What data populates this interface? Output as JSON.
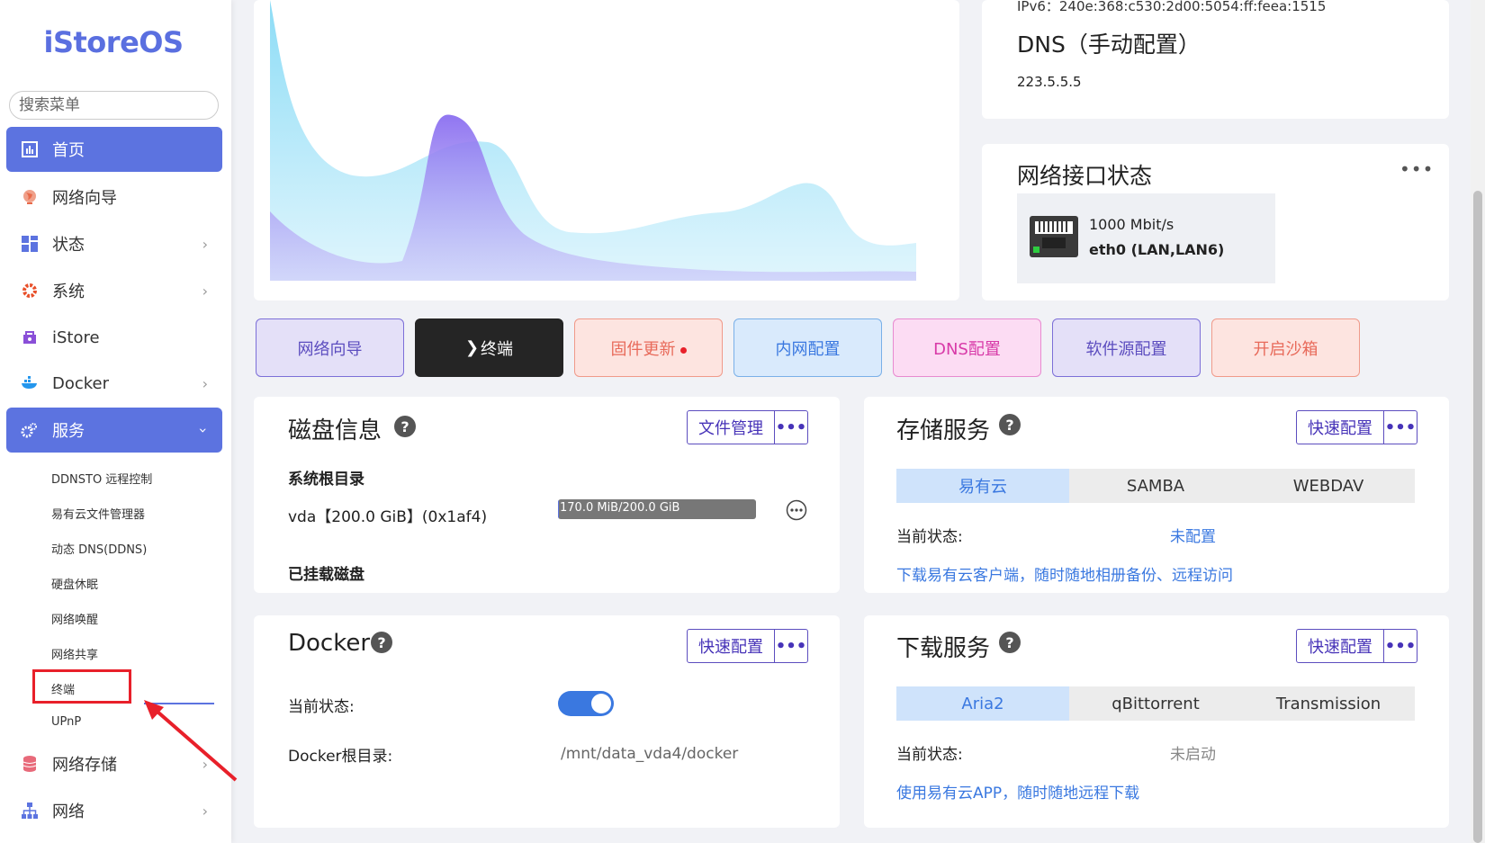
{
  "sidebar": {
    "logo": "iStoreOS",
    "search_placeholder": "搜索菜单",
    "items": [
      {
        "label": "首页",
        "icon": "dashboard-icon"
      },
      {
        "label": "网络向导",
        "icon": "globe-icon"
      },
      {
        "label": "状态",
        "icon": "grid-icon"
      },
      {
        "label": "系统",
        "icon": "gear-icon"
      },
      {
        "label": "iStore",
        "icon": "store-icon"
      },
      {
        "label": "Docker",
        "icon": "docker-icon"
      },
      {
        "label": "服务",
        "icon": "services-icon"
      },
      {
        "label": "网络存储",
        "icon": "storage-icon"
      },
      {
        "label": "网络",
        "icon": "network-icon"
      }
    ],
    "sub_items": [
      "DDNSTO 远程控制",
      "易有云文件管理器",
      "动态 DNS(DDNS)",
      "硬盘休眠",
      "网络唤醒",
      "网络共享",
      "终端",
      "UPnP"
    ]
  },
  "network": {
    "ipv6": "IPv6：240e:368:c530:2d00:5054:ff:feea:1515",
    "dns_title": "DNS（手动配置）",
    "dns_value": "223.5.5.5"
  },
  "interface": {
    "title": "网络接口状态",
    "speed": "1000 Mbit/s",
    "name": "eth0 (LAN,LAN6)"
  },
  "actions": [
    {
      "label": "网络向导"
    },
    {
      "label": "终端",
      "prefix": "❯"
    },
    {
      "label": "固件更新"
    },
    {
      "label": "内网配置"
    },
    {
      "label": "DNS配置"
    },
    {
      "label": "软件源配置"
    },
    {
      "label": "开启沙箱"
    }
  ],
  "disk": {
    "title": "磁盘信息",
    "button": "文件管理",
    "root_label": "系统根目录",
    "vda": "vda【200.0 GiB】(0x1af4)",
    "usage_text": "170.0 MiB/200.0 GiB",
    "usage_fraction": 0.0008,
    "mounted_label": "已挂载磁盘"
  },
  "storage": {
    "title": "存储服务",
    "button": "快速配置",
    "tabs": [
      "易有云",
      "SAMBA",
      "WEBDAV"
    ],
    "status_label": "当前状态:",
    "status_value": "未配置",
    "link": "下载易有云客户端，随时随地相册备份、远程访问"
  },
  "docker": {
    "title": "Docker",
    "button": "快速配置",
    "status_label": "当前状态:",
    "root_label": "Docker根目录:",
    "root_value": "/mnt/data_vda4/docker",
    "enabled": true
  },
  "download": {
    "title": "下载服务",
    "button": "快速配置",
    "tabs": [
      "Aria2",
      "qBittorrent",
      "Transmission"
    ],
    "status_label": "当前状态:",
    "status_value": "未启动",
    "link": "使用易有云APP，随时随地远程下载"
  },
  "colors": {
    "accent": "#5c73e0",
    "link": "#3a78e0",
    "highlight": "#e8202a"
  }
}
